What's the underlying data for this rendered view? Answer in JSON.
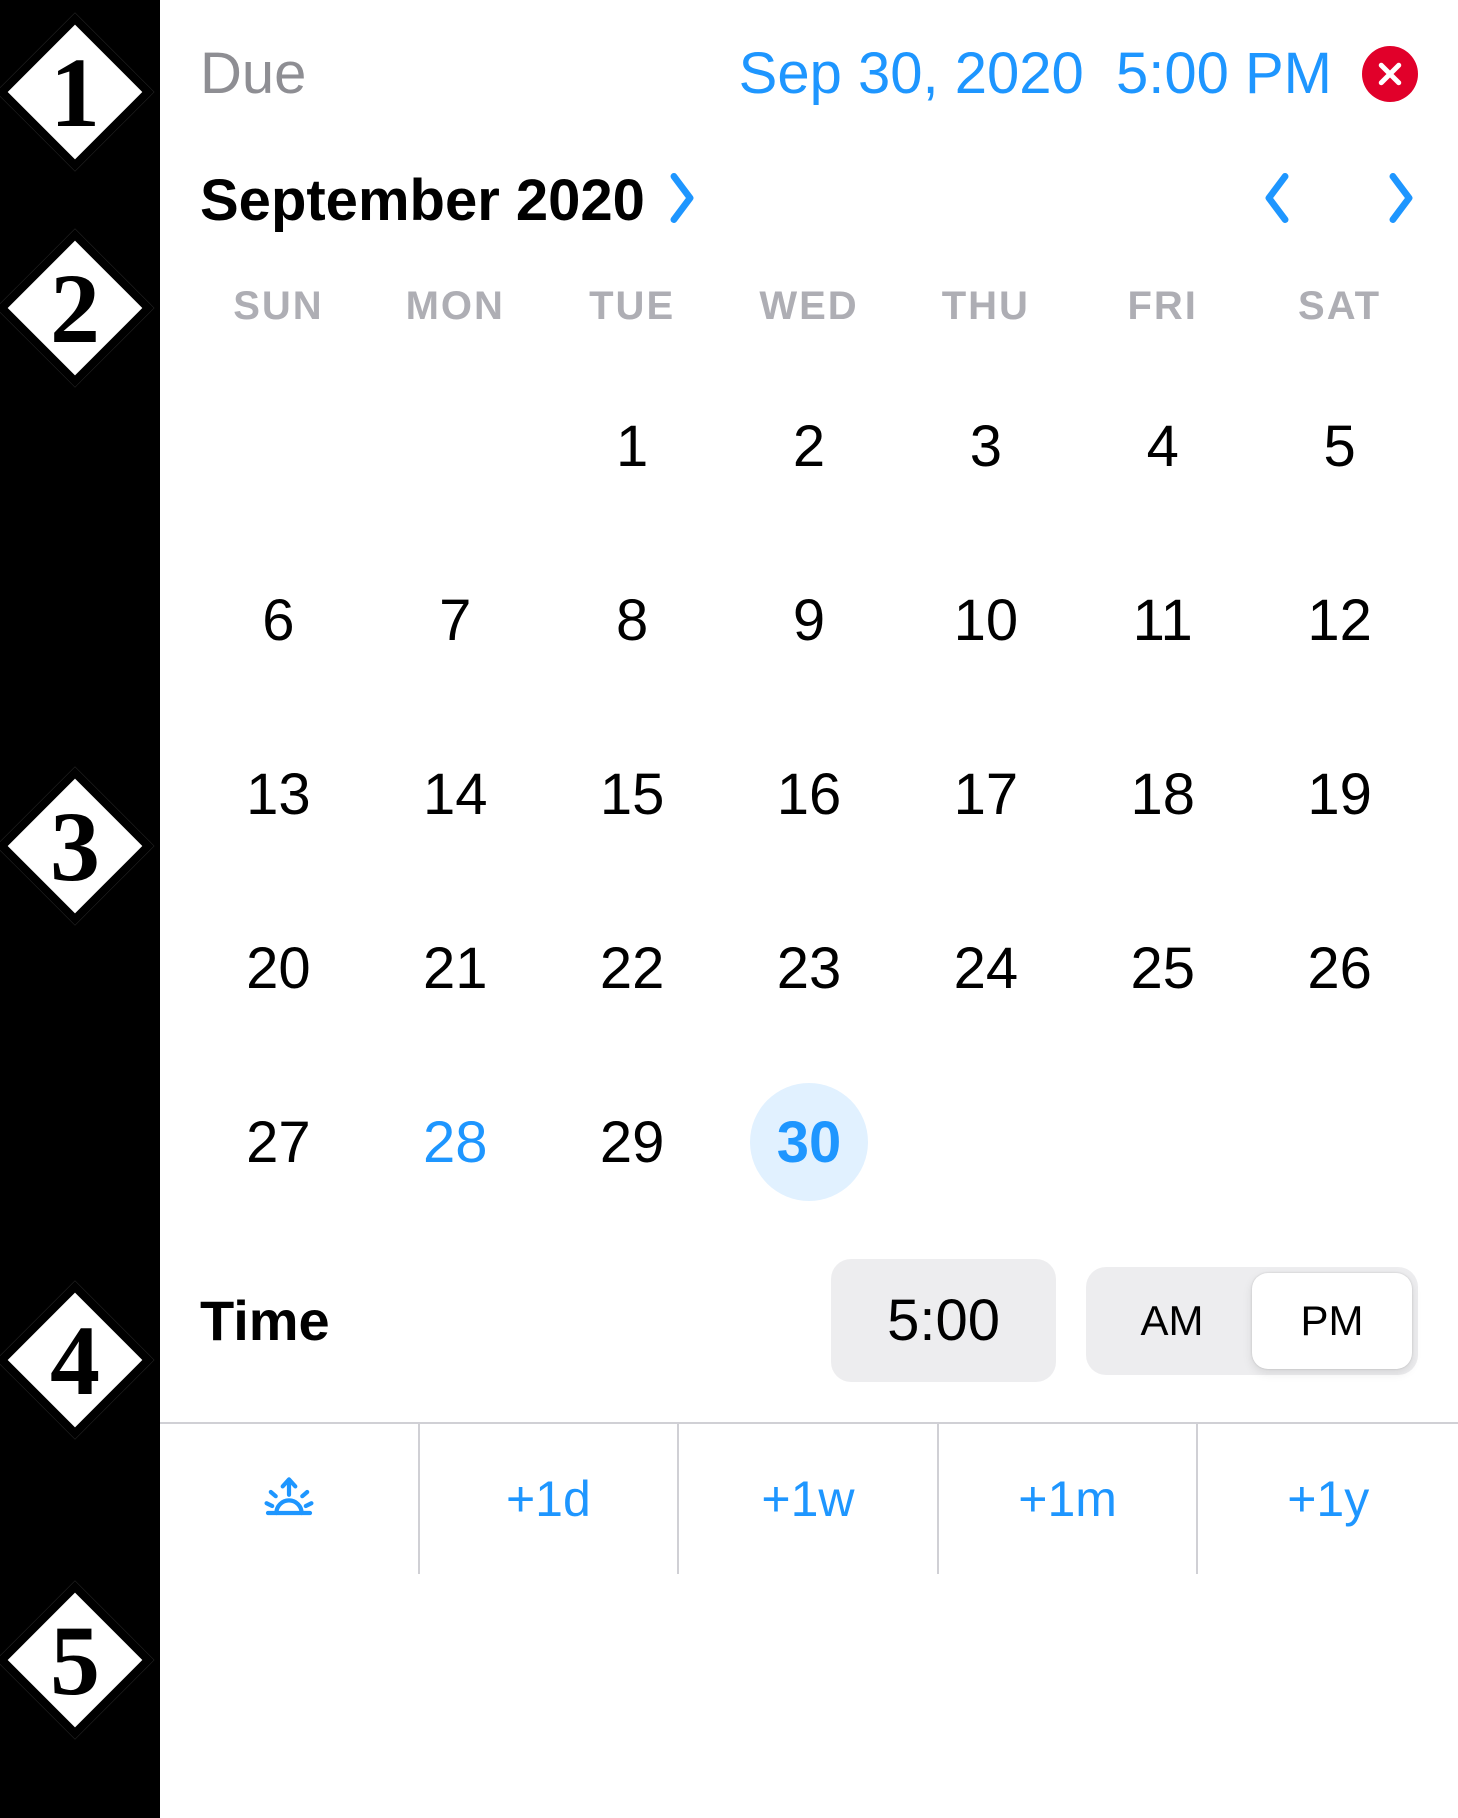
{
  "markers": [
    "1",
    "2",
    "3",
    "4",
    "5"
  ],
  "header": {
    "label": "Due",
    "date_value": "Sep 30, 2020",
    "time_value": "5:00 PM"
  },
  "month": {
    "title": "September 2020"
  },
  "weekdays": [
    "SUN",
    "MON",
    "TUE",
    "WED",
    "THU",
    "FRI",
    "SAT"
  ],
  "calendar": {
    "leading_blanks": 2,
    "days": 30,
    "today": 28,
    "selected": 30
  },
  "time": {
    "label": "Time",
    "value": "5:00",
    "ampm": [
      "AM",
      "PM"
    ],
    "ampm_active": "PM"
  },
  "shortcuts": [
    "+1d",
    "+1w",
    "+1m",
    "+1y"
  ]
}
